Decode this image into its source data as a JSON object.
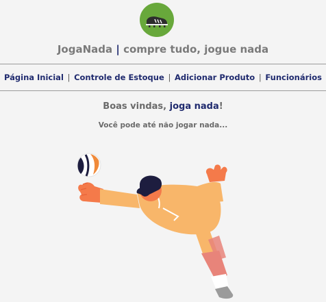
{
  "header": {
    "logo_icon": "soccer-cleat-icon",
    "brand_name": "JogaNada",
    "brand_separator": "|",
    "brand_slogan": "compre tudo, jogue nada"
  },
  "nav": {
    "items": [
      {
        "label": "Página Inicial"
      },
      {
        "label": "Controle de Estoque"
      },
      {
        "label": "Adicionar Produto"
      },
      {
        "label": "Funcionários"
      }
    ],
    "separator": "|"
  },
  "main": {
    "welcome_prefix": "Boas vindas, ",
    "username": "joga nada",
    "welcome_suffix": "!",
    "tagline": "Você pode até não jogar nada...",
    "illustration": "goalkeeper-diving-illustration"
  },
  "colors": {
    "logo_bg": "#68a83b",
    "link": "#1f2a6e",
    "text_muted": "#7a7a7a",
    "background": "#f4f4f4",
    "jersey": "#f8b66a",
    "glove": "#f47a4a"
  }
}
